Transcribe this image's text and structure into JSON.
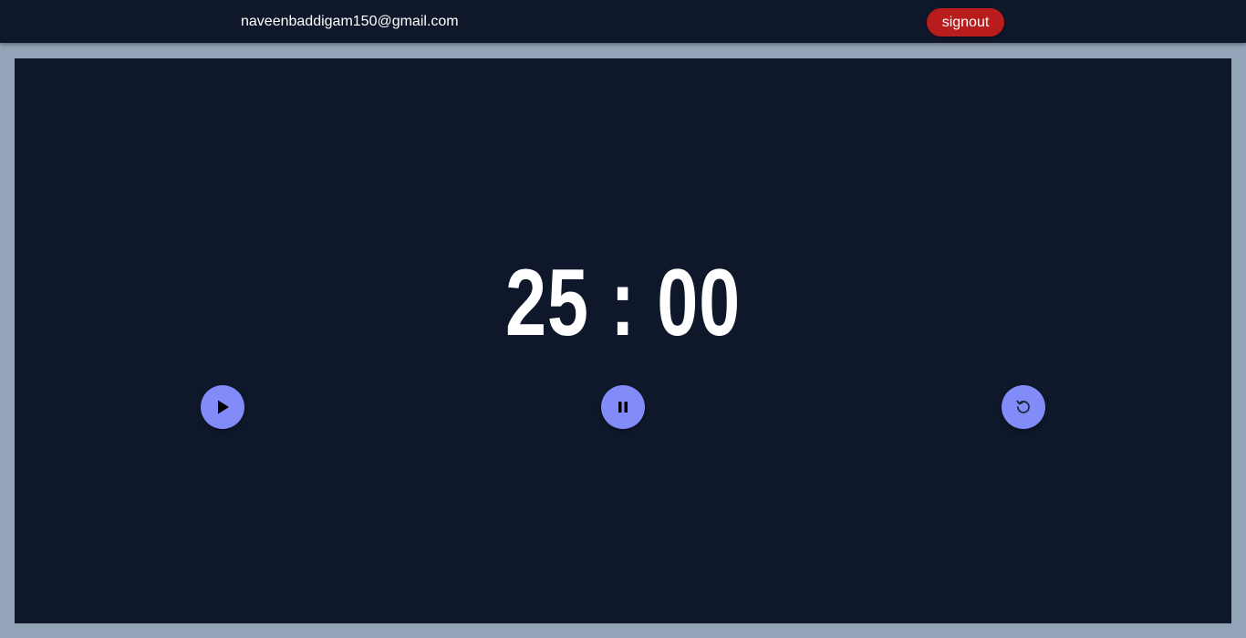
{
  "header": {
    "user_email": "naveenbaddigam150@gmail.com",
    "signout_label": "signout"
  },
  "timer": {
    "display": "25 : 00",
    "minutes": 25,
    "seconds": 0
  },
  "controls": [
    {
      "name": "play",
      "icon": "play-icon"
    },
    {
      "name": "pause",
      "icon": "pause-icon"
    },
    {
      "name": "reset",
      "icon": "reset-icon"
    }
  ],
  "colors": {
    "background": "#0f172a",
    "page_border": "#94a3b8",
    "accent": "#818cf8",
    "signout": "#b91c1c"
  }
}
